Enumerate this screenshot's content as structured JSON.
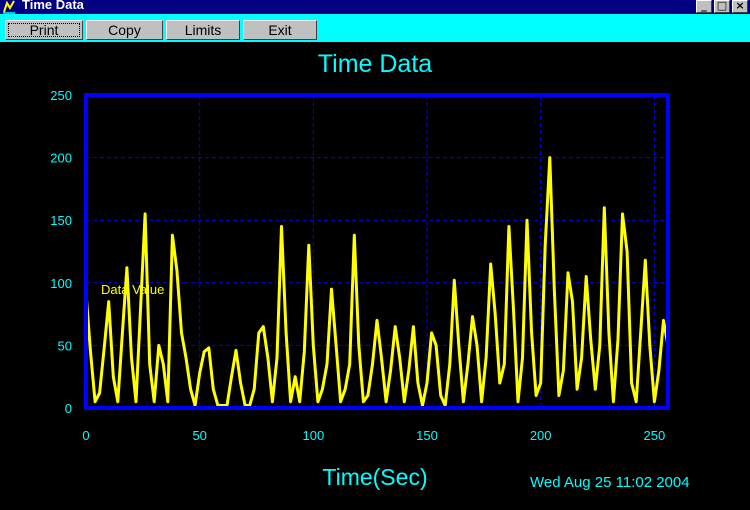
{
  "window": {
    "title": "Time Data",
    "controls": [
      "minimize",
      "maximize",
      "close"
    ]
  },
  "toolbar": {
    "print_label": "Print",
    "copy_label": "Copy",
    "limits_label": "Limits",
    "exit_label": "Exit"
  },
  "chart_data": {
    "type": "line",
    "title": "Time Data",
    "xlabel": "Time(Sec)",
    "ylabel": "",
    "xlim": [
      0,
      256
    ],
    "ylim": [
      0,
      250
    ],
    "xticks": [
      0,
      50,
      100,
      150,
      200,
      250
    ],
    "yticks": [
      0,
      50,
      100,
      150,
      200,
      250
    ],
    "grid": true,
    "series": [
      {
        "name": "Data Value",
        "color": "#ffff00",
        "x": [
          0,
          2,
          4,
          6,
          8,
          10,
          12,
          14,
          16,
          18,
          20,
          22,
          24,
          26,
          28,
          30,
          32,
          34,
          36,
          38,
          40,
          42,
          44,
          46,
          48,
          50,
          52,
          54,
          56,
          58,
          60,
          62,
          64,
          66,
          68,
          70,
          72,
          74,
          76,
          78,
          80,
          82,
          84,
          86,
          88,
          90,
          92,
          94,
          96,
          98,
          100,
          102,
          104,
          106,
          108,
          110,
          112,
          114,
          116,
          118,
          120,
          122,
          124,
          126,
          128,
          130,
          132,
          134,
          136,
          138,
          140,
          142,
          144,
          146,
          148,
          150,
          152,
          154,
          156,
          158,
          160,
          162,
          164,
          166,
          168,
          170,
          172,
          174,
          176,
          178,
          180,
          182,
          184,
          186,
          188,
          190,
          192,
          194,
          196,
          198,
          200,
          202,
          204,
          206,
          208,
          210,
          212,
          214,
          216,
          218,
          220,
          222,
          224,
          226,
          228,
          230,
          232,
          234,
          236,
          238,
          240,
          242,
          244,
          246,
          248,
          250,
          252,
          254,
          256
        ],
        "y": [
          92,
          45,
          5,
          12,
          48,
          85,
          25,
          5,
          60,
          112,
          40,
          5,
          80,
          155,
          35,
          5,
          50,
          35,
          5,
          138,
          110,
          60,
          40,
          15,
          2,
          28,
          45,
          48,
          15,
          2,
          2,
          2,
          25,
          46,
          20,
          2,
          2,
          15,
          60,
          65,
          40,
          5,
          40,
          145,
          60,
          5,
          25,
          5,
          45,
          130,
          50,
          5,
          15,
          35,
          95,
          50,
          5,
          15,
          35,
          138,
          50,
          5,
          10,
          35,
          70,
          40,
          5,
          30,
          65,
          40,
          5,
          30,
          65,
          20,
          2,
          20,
          60,
          50,
          10,
          2,
          35,
          102,
          50,
          5,
          35,
          73,
          50,
          5,
          40,
          115,
          75,
          20,
          35,
          145,
          80,
          5,
          40,
          150,
          60,
          10,
          20,
          130,
          200,
          95,
          10,
          30,
          108,
          85,
          15,
          40,
          105,
          55,
          15,
          50,
          160,
          60,
          5,
          55,
          155,
          125,
          20,
          5,
          60,
          118,
          50,
          5,
          30,
          70,
          50
        ]
      }
    ],
    "timestamp": "Wed Aug 25 11:02 2004"
  },
  "colors": {
    "background": "#000000",
    "plot_border": "#0000ff",
    "grid": "#0000ff",
    "axis_text": "#00ffff",
    "toolbar_bg": "#00ffff",
    "titlebar_bg": "#000080"
  }
}
